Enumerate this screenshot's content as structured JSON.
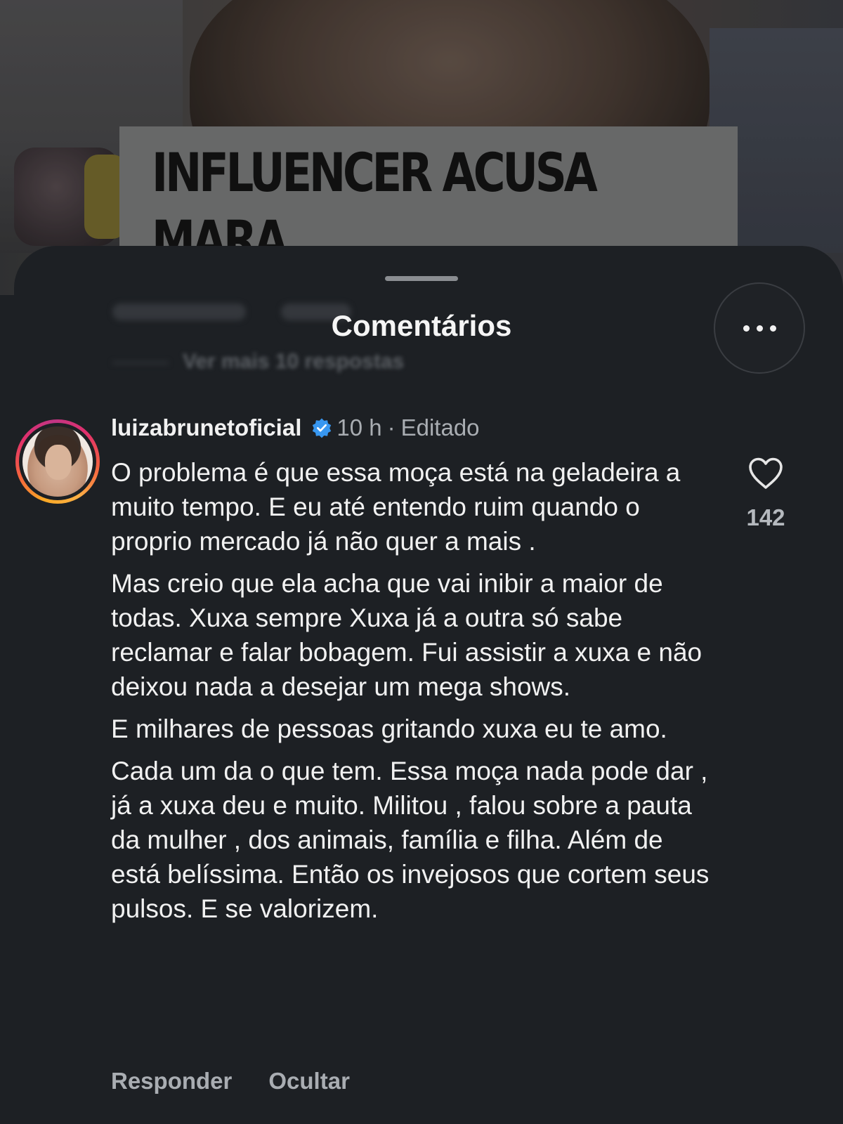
{
  "video": {
    "headline": "INFLUENCER ACUSA MARA\nMARAVILHA DE ESPALHAR"
  },
  "background_thread": {
    "blurred_reply_label": "Responder",
    "blurred_hide_label": "Ocultar",
    "view_more_replies": "Ver mais 10 respostas"
  },
  "sheet": {
    "title": "Comentários",
    "more_icon": "ellipsis-icon"
  },
  "comment": {
    "username": "luizabrunetoficial",
    "verified_icon": "verified-badge-icon",
    "time": "10 h",
    "separator": "·",
    "edited": "Editado",
    "paragraphs": [
      "O problema é que essa moça está na geladeira a muito tempo. E eu até entendo ruim quando o proprio mercado já não quer a mais .",
      "Mas creio que ela acha que vai inibir a maior de todas. Xuxa sempre  Xuxa já a outra só sabe reclamar e falar bobagem. Fui assistir a xuxa e não deixou nada a desejar um mega shows.",
      "E milhares de pessoas gritando xuxa eu te amo.",
      "Cada um da o que tem. Essa moça nada pode dar , já a xuxa deu e muito. Militou , falou sobre a pauta da mulher , dos animais, família e filha. Além de está belíssima. Então os invejosos que cortem seus pulsos. E se valorizem."
    ],
    "like_icon": "heart-icon",
    "like_count": "142",
    "reply_label": "Responder",
    "hide_label": "Ocultar"
  },
  "colors": {
    "sheet_background": "#1d2024",
    "text_primary": "#f1f1f1",
    "text_secondary": "#a9adb2",
    "verified_blue": "#3897f0"
  }
}
